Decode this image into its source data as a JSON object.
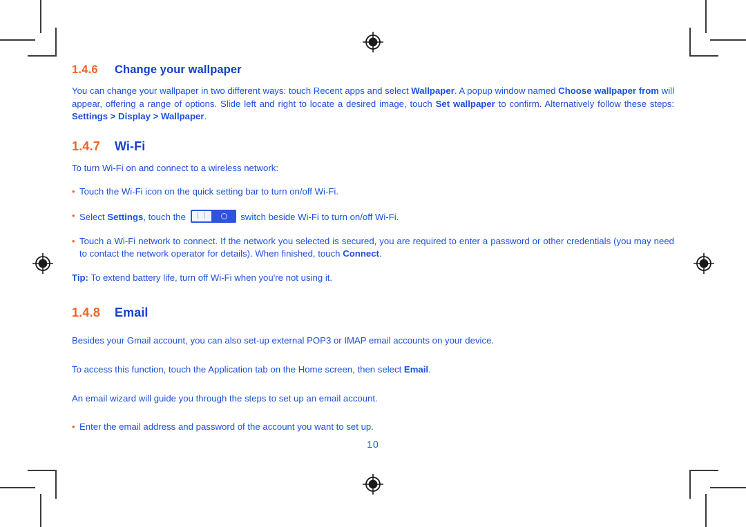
{
  "page": {
    "number": "10",
    "colors": {
      "accent_orange": "#F4621F",
      "text_blue": "#1B50DD",
      "heading_blue": "#1240CE",
      "crop_mark": "#3a3a3a",
      "toggle_blue": "#2E54DF"
    }
  },
  "sections": {
    "wallpaper": {
      "number": "1.4.6",
      "title": "Change your wallpaper",
      "paragraph": {
        "p1": "You can change your wallpaper in two different ways: touch Recent apps and select ",
        "b1": "Wallpaper",
        "p2": ". A popup window named ",
        "b2": "Choose wallpaper from",
        "p3": " will appear, offering a range of options. Slide left and right to locate a desired image, touch ",
        "b3": "Set wallpaper",
        "p4": " to confirm. Alternatively follow these steps: ",
        "b4": "Settings > Display > Wallpaper",
        "p5": "."
      }
    },
    "wifi": {
      "number": "1.4.7",
      "title": "Wi-Fi",
      "intro": "To turn Wi-Fi on and connect to a wireless network:",
      "bullets": {
        "b1": {
          "marker": "•",
          "text": "Touch the Wi-Fi icon on the quick setting bar to turn on/off Wi-Fi."
        },
        "b2": {
          "marker": "•",
          "pre": "Select ",
          "bold": "Settings",
          "mid": ", touch the ",
          "toggle_icon": "toggle-switch-icon",
          "toggle_bars": "❘❘",
          "post": " switch beside Wi-Fi to turn on/off Wi-Fi."
        },
        "b3": {
          "marker": "•",
          "pre": "Touch a Wi-Fi network to connect. If the network you selected is secured, you are required to enter a password or other credentials (you may need to contact the network operator for details). When finished, touch ",
          "bold": "Connect",
          "post": "."
        }
      },
      "tip": {
        "label": "Tip:",
        "text": " To extend battery life, turn off Wi-Fi when you're not using it."
      }
    },
    "email": {
      "number": "1.4.8",
      "title": "Email",
      "p1": "Besides your Gmail account, you can also set-up external POP3 or IMAP email accounts on your device.",
      "p2_pre": "To access this function, touch the Application tab on the Home screen, then select ",
      "p2_bold": "Email",
      "p2_post": ".",
      "p3": "An email wizard will guide you through the steps to set up an email account.",
      "bullet": {
        "marker": "•",
        "text": "Enter the email address and password of the account you want to set up."
      }
    }
  }
}
